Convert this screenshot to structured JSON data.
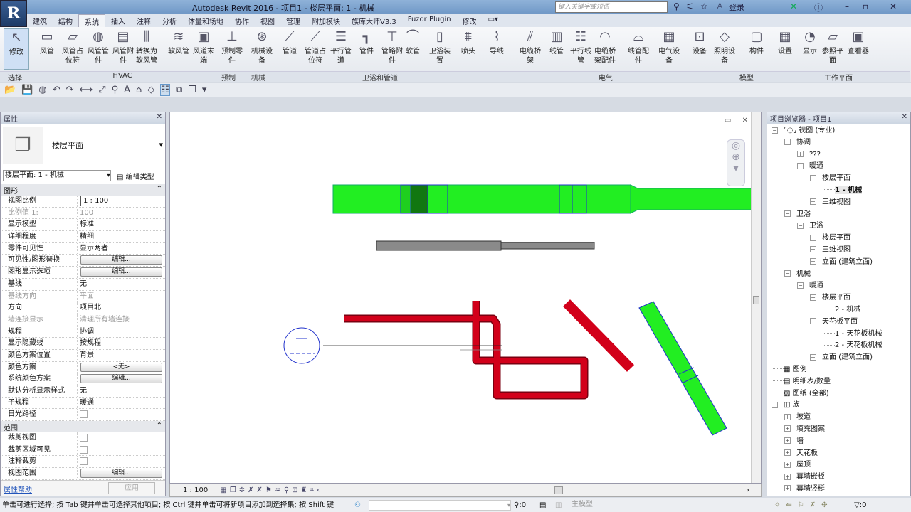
{
  "app": {
    "title": "Autodesk Revit 2016 -   项目1 - 楼层平面: 1 - 机械",
    "logo": "R",
    "search_placeholder": "键入关键字或短语",
    "login": "登录"
  },
  "tabs": [
    "建筑",
    "结构",
    "系统",
    "插入",
    "注释",
    "分析",
    "体量和场地",
    "协作",
    "视图",
    "管理",
    "附加模块",
    "族库大师V3.3",
    "Fuzor Plugin",
    "修改"
  ],
  "active_tab": "系统",
  "ribbon": {
    "buttons": [
      {
        "label": "修改",
        "icon": "↖"
      },
      {
        "label": "风管",
        "icon": "▭"
      },
      {
        "label": "风管占位符",
        "icon": "▱"
      },
      {
        "label": "风管管件",
        "icon": "◍"
      },
      {
        "label": "风管附件",
        "icon": "▤"
      },
      {
        "label": "转换为软风管",
        "icon": "⫼"
      },
      {
        "label": "软风管",
        "icon": "≋"
      },
      {
        "label": "风道末端",
        "icon": "▣"
      },
      {
        "label": "预制零件",
        "icon": "⊥"
      },
      {
        "label": "机械设备",
        "icon": "⊛"
      },
      {
        "label": "管道",
        "icon": "⟋"
      },
      {
        "label": "管道占位符",
        "icon": "⟋"
      },
      {
        "label": "平行管道",
        "icon": "☰"
      },
      {
        "label": "管件",
        "icon": "┓"
      },
      {
        "label": "管路附件",
        "icon": "⊤"
      },
      {
        "label": "软管",
        "icon": "⌒"
      },
      {
        "label": "卫浴装置",
        "icon": "▯"
      },
      {
        "label": "喷头",
        "icon": "⩩"
      },
      {
        "label": "导线",
        "icon": "⌇"
      },
      {
        "label": "电缆桥架",
        "icon": "⫽"
      },
      {
        "label": "线管",
        "icon": "▥"
      },
      {
        "label": "平行线管",
        "icon": "☷"
      },
      {
        "label": "电缆桥架配件",
        "icon": "◠"
      },
      {
        "label": "线管配件",
        "icon": "⌓"
      },
      {
        "label": "电气设备",
        "icon": "▦"
      },
      {
        "label": "设备",
        "icon": "⊡"
      },
      {
        "label": "照明设备",
        "icon": "◇"
      },
      {
        "label": "构件",
        "icon": "▢"
      },
      {
        "label": "设置",
        "icon": "▦"
      },
      {
        "label": "显示",
        "icon": "◔"
      },
      {
        "label": "参照平面",
        "icon": "▱"
      },
      {
        "label": "查看器",
        "icon": "▣"
      }
    ],
    "panels": [
      "选择",
      "HVAC",
      "预制",
      "机械",
      "卫浴和管道",
      "电气",
      "模型",
      "工作平面"
    ]
  },
  "properties": {
    "title": "属性",
    "type_name": "楼层平面",
    "selector": "楼层平面: 1 - 机械",
    "edit_type": "编辑类型",
    "section_graphics": "图形",
    "section_range": "范围",
    "rows": [
      {
        "k": "视图比例",
        "v": "1 : 100",
        "kind": "input"
      },
      {
        "k": "比例值 1:",
        "v": "100",
        "kind": "dim"
      },
      {
        "k": "显示模型",
        "v": "标准"
      },
      {
        "k": "详细程度",
        "v": "精细"
      },
      {
        "k": "零件可见性",
        "v": "显示两者"
      },
      {
        "k": "可见性/图形替换",
        "v": "编辑...",
        "kind": "btn"
      },
      {
        "k": "图形显示选项",
        "v": "编辑...",
        "kind": "btn"
      },
      {
        "k": "基线",
        "v": "无"
      },
      {
        "k": "基线方向",
        "v": "平面",
        "kind": "dim"
      },
      {
        "k": "方向",
        "v": "项目北"
      },
      {
        "k": "墙连接显示",
        "v": "清理所有墙连接",
        "kind": "dim"
      },
      {
        "k": "规程",
        "v": "协调"
      },
      {
        "k": "显示隐藏线",
        "v": "按规程"
      },
      {
        "k": "颜色方案位置",
        "v": "背景"
      },
      {
        "k": "颜色方案",
        "v": "<无>",
        "kind": "btn"
      },
      {
        "k": "系统颜色方案",
        "v": "编辑...",
        "kind": "btn"
      },
      {
        "k": "默认分析显示样式",
        "v": "无"
      },
      {
        "k": "子规程",
        "v": "暖通"
      },
      {
        "k": "日光路径",
        "v": "",
        "kind": "cb"
      }
    ],
    "range_rows": [
      {
        "k": "裁剪视图",
        "v": "",
        "kind": "cb"
      },
      {
        "k": "裁剪区域可见",
        "v": "",
        "kind": "cb"
      },
      {
        "k": "注释裁剪",
        "v": "",
        "kind": "cb"
      },
      {
        "k": "视图范围",
        "v": "编辑...",
        "kind": "btn"
      }
    ],
    "help": "属性帮助",
    "apply": "应用"
  },
  "browser": {
    "title": "项目浏览器 - 项目1",
    "items": [
      {
        "t": "视图 (专业)",
        "d": 0,
        "pm": "−"
      },
      {
        "t": "协调",
        "d": 1,
        "pm": "−"
      },
      {
        "t": "???",
        "d": 2,
        "pm": "+"
      },
      {
        "t": "暖通",
        "d": 2,
        "pm": "−"
      },
      {
        "t": "楼层平面",
        "d": 3,
        "pm": "−"
      },
      {
        "t": "1 - 机械",
        "d": 4,
        "pm": "",
        "bold": true
      },
      {
        "t": "三维视图",
        "d": 3,
        "pm": "+"
      },
      {
        "t": "卫浴",
        "d": 1,
        "pm": "−"
      },
      {
        "t": "卫浴",
        "d": 2,
        "pm": "−"
      },
      {
        "t": "楼层平面",
        "d": 3,
        "pm": "+"
      },
      {
        "t": "三维视图",
        "d": 3,
        "pm": "+"
      },
      {
        "t": "立面 (建筑立面)",
        "d": 3,
        "pm": "+"
      },
      {
        "t": "机械",
        "d": 1,
        "pm": "−"
      },
      {
        "t": "暖通",
        "d": 2,
        "pm": "−"
      },
      {
        "t": "楼层平面",
        "d": 3,
        "pm": "−"
      },
      {
        "t": "2 - 机械",
        "d": 4,
        "pm": ""
      },
      {
        "t": "天花板平面",
        "d": 3,
        "pm": "−"
      },
      {
        "t": "1 - 天花板机械",
        "d": 4,
        "pm": ""
      },
      {
        "t": "2 - 天花板机械",
        "d": 4,
        "pm": ""
      },
      {
        "t": "立面 (建筑立面)",
        "d": 3,
        "pm": "+"
      },
      {
        "t": "图例",
        "d": 0,
        "pm": "",
        "icon": "▦"
      },
      {
        "t": "明细表/数量",
        "d": 0,
        "pm": "",
        "icon": "▤"
      },
      {
        "t": "图纸 (全部)",
        "d": 0,
        "pm": "",
        "icon": "▧"
      },
      {
        "t": "族",
        "d": 0,
        "pm": "−",
        "icon": "◫"
      },
      {
        "t": "坡道",
        "d": 1,
        "pm": "+"
      },
      {
        "t": "填充图案",
        "d": 1,
        "pm": "+"
      },
      {
        "t": "墙",
        "d": 1,
        "pm": "+"
      },
      {
        "t": "天花板",
        "d": 1,
        "pm": "+"
      },
      {
        "t": "屋顶",
        "d": 1,
        "pm": "+"
      },
      {
        "t": "幕墙嵌板",
        "d": 1,
        "pm": "+"
      },
      {
        "t": "幕墙竖梃",
        "d": 1,
        "pm": "+"
      }
    ]
  },
  "view": {
    "scale": "1 : 100"
  },
  "status": {
    "hint": "单击可进行选择; 按 Tab 键并单击可选择其他项目; 按 Ctrl 键并单击可将新项目添加到选择集; 按 Shift 键",
    "count": ":0",
    "model": "主模型",
    "filter_count": ":0"
  },
  "colors": {
    "duct": "#22ee22",
    "pipe_red": "#d2001a",
    "pipe_gray": "#8a8a8a",
    "outline_blue": "#2233cc"
  }
}
